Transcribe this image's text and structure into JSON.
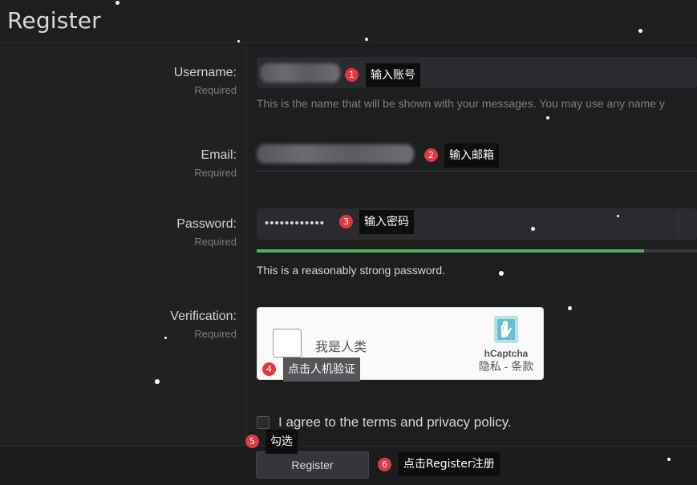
{
  "page": {
    "title": "Register"
  },
  "form": {
    "username": {
      "label": "Username:",
      "required": "Required",
      "hint": "This is the name that will be shown with your messages. You may use any name y"
    },
    "email": {
      "label": "Email:",
      "required": "Required"
    },
    "password": {
      "label": "Password:",
      "required": "Required",
      "value": "••••••••••••",
      "strength_text": "This is a reasonably strong password.",
      "strength_fraction": 0.88
    },
    "verification": {
      "label": "Verification:",
      "required": "Required"
    },
    "agree_text": "I agree to the terms and privacy policy.",
    "register_label": "Register"
  },
  "captcha": {
    "checkbox_text": "我是人类",
    "brand": "hCaptcha",
    "links": "隐私 - 条款"
  },
  "annotations": [
    {
      "num": "1",
      "text": "输入账号"
    },
    {
      "num": "2",
      "text": "输入邮箱"
    },
    {
      "num": "3",
      "text": "输入密码"
    },
    {
      "num": "4",
      "text": "点击人机验证"
    },
    {
      "num": "5",
      "text": "勾选"
    },
    {
      "num": "6",
      "text": "点击Register注册"
    }
  ],
  "colors": {
    "strength_bar": "#5aa85e",
    "badge": "#e0393e",
    "hcaptcha_icon": "#3fb1c7"
  }
}
